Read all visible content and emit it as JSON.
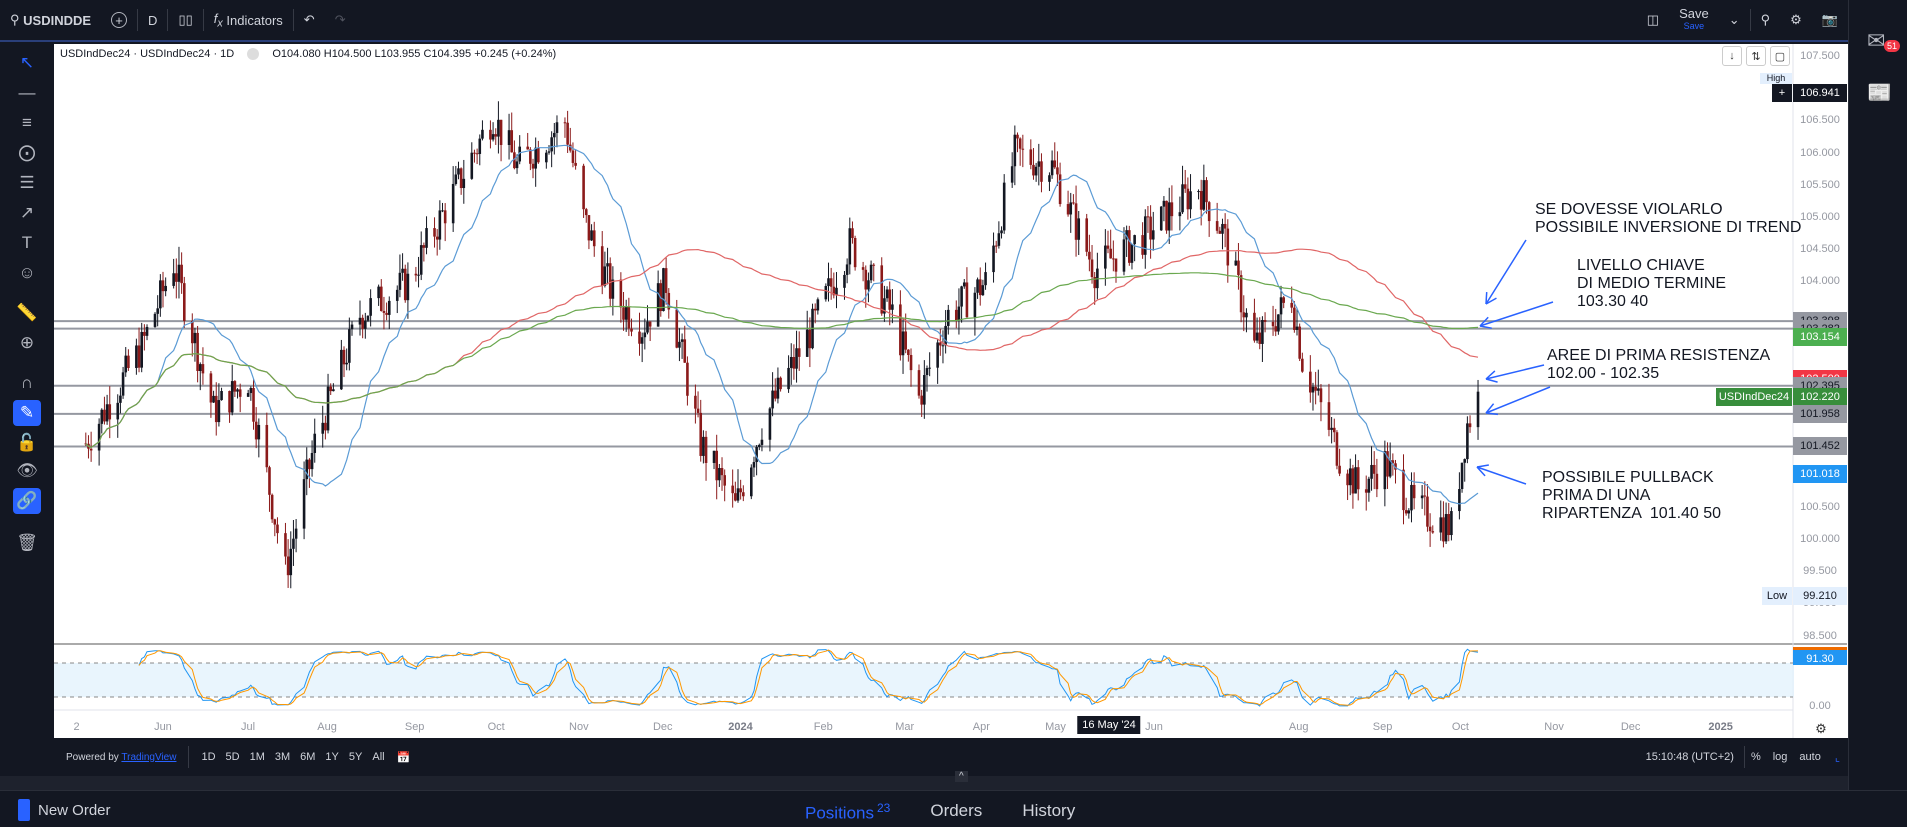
{
  "toolbar": {
    "symbol": "USDINDDE",
    "interval": "D",
    "indicators": "Indicators",
    "save": "Save",
    "save_sub": "Save"
  },
  "legend": {
    "title": "USDIndDec24 · USDIndDec24 · 1D",
    "ohlc": "O104.080 H104.500 L103.955 C104.395 +0.245 (+0.24%)"
  },
  "right_sidebar": {
    "mail_badge": "51"
  },
  "price_axis": {
    "ticks": [
      "107.500",
      "106.500",
      "106.000",
      "105.500",
      "105.000",
      "104.500",
      "104.000",
      "100.500",
      "100.000",
      "99.500",
      "99.000",
      "98.500"
    ],
    "labels": [
      {
        "v": "106.941",
        "c": "#131722",
        "t": "#ffffff",
        "p": 106.941
      },
      {
        "v": "103.398",
        "c": "#9598a1",
        "t": "#131722",
        "p": 103.398
      },
      {
        "v": "103.282",
        "c": "#9598a1",
        "t": "#131722",
        "p": 103.282
      },
      {
        "v": "103.154",
        "c": "#4caf50",
        "t": "#ffffff",
        "p": 103.154
      },
      {
        "v": "102.500",
        "c": "#f23645",
        "t": "#ffffff",
        "p": 102.5
      },
      {
        "v": "102.395",
        "c": "#9598a1",
        "t": "#131722",
        "p": 102.395
      },
      {
        "v": "102.220",
        "c": "#388e3c",
        "t": "#ffffff",
        "p": 102.22
      },
      {
        "v": "101.958",
        "c": "#9598a1",
        "t": "#131722",
        "p": 101.958
      },
      {
        "v": "101.452",
        "c": "#9598a1",
        "t": "#131722",
        "p": 101.452
      },
      {
        "v": "101.018",
        "c": "#2196f3",
        "t": "#ffffff",
        "p": 101.018
      }
    ],
    "symbol_tag": "USDIndDec24",
    "high_label": "High",
    "low_label": "Low",
    "low_value": "99.210",
    "rsi_value": "91.30",
    "rsi_zero": "0.00"
  },
  "levels": [
    103.398,
    103.282,
    102.395,
    101.958,
    101.452
  ],
  "annotations": [
    {
      "lines": [
        "SE DOVESSE VIOLARLO",
        "POSSIBILE INVERSIONE DI TREND"
      ]
    },
    {
      "lines": [
        "LIVELLO CHIAVE",
        "DI MEDIO TERMINE",
        "103.30 40"
      ]
    },
    {
      "lines": [
        "AREE DI PRIMA RESISTENZA",
        "102.00 - 102.35"
      ]
    },
    {
      "lines": [
        "POSSIBILE PULLBACK",
        "PRIMA DI UNA",
        "RIPARTENZA  101.40 50"
      ]
    }
  ],
  "time_axis": {
    "labels": [
      "2",
      "Jun",
      "Jul",
      "Aug",
      "Sep",
      "Oct",
      "Nov",
      "Dec",
      "2024",
      "Feb",
      "Mar",
      "Apr",
      "May",
      "Jun",
      "Aug",
      "Sep",
      "Oct",
      "Nov",
      "Dec",
      "2025"
    ],
    "crosshair": "16 May '24"
  },
  "bottom_toolbar": {
    "powered": "Powered by",
    "brand": "TradingView",
    "ranges": [
      "1D",
      "5D",
      "1M",
      "3M",
      "6M",
      "1Y",
      "5Y",
      "All"
    ],
    "time": "15:10:48 (UTC+2)",
    "pct": "%",
    "log": "log",
    "auto": "auto"
  },
  "panel": {
    "new_order": "New Order",
    "tabs": [
      {
        "label": "Positions",
        "badge": "23",
        "active": true
      },
      {
        "label": "Orders"
      },
      {
        "label": "History"
      }
    ]
  },
  "colors": {
    "up": "#131722",
    "down": "#8b1a1a",
    "ma_fast": "#5b9bd5",
    "ma_mid": "#e06666",
    "ma_slow": "#6aa84f",
    "accent": "#2962ff"
  },
  "chart_data": {
    "type": "candlestick",
    "symbol": "USDIndDec24",
    "price_path": [
      [
        "2023-05-03",
        101.5
      ],
      [
        "2023-05-24",
        103.0
      ],
      [
        "2023-06-05",
        104.3
      ],
      [
        "2023-06-20",
        102.0
      ],
      [
        "2023-07-03",
        102.5
      ],
      [
        "2023-07-17",
        99.5
      ],
      [
        "2023-07-28",
        101.5
      ],
      [
        "2023-08-14",
        103.5
      ],
      [
        "2023-09-01",
        104.0
      ],
      [
        "2023-09-22",
        105.7
      ],
      [
        "2023-10-03",
        106.6
      ],
      [
        "2023-10-12",
        105.8
      ],
      [
        "2023-10-30",
        106.5
      ],
      [
        "2023-11-06",
        105.0
      ],
      [
        "2023-11-17",
        103.8
      ],
      [
        "2023-11-28",
        103.3
      ],
      [
        "2023-12-07",
        104.0
      ],
      [
        "2023-12-20",
        101.5
      ],
      [
        "2024-01-02",
        100.5
      ],
      [
        "2024-01-12",
        101.8
      ],
      [
        "2024-01-31",
        103.3
      ],
      [
        "2024-02-14",
        104.6
      ],
      [
        "2024-03-01",
        103.5
      ],
      [
        "2024-03-11",
        102.2
      ],
      [
        "2024-03-22",
        103.5
      ],
      [
        "2024-04-05",
        104.0
      ],
      [
        "2024-04-16",
        106.0
      ],
      [
        "2024-04-30",
        105.8
      ],
      [
        "2024-05-16",
        104.2
      ],
      [
        "2024-06-03",
        104.7
      ],
      [
        "2024-06-24",
        105.5
      ],
      [
        "2024-07-03",
        104.8
      ],
      [
        "2024-07-15",
        103.0
      ],
      [
        "2024-07-29",
        103.8
      ],
      [
        "2024-08-02",
        102.8
      ],
      [
        "2024-08-16",
        101.3
      ],
      [
        "2024-08-23",
        100.8
      ],
      [
        "2024-09-02",
        101.2
      ],
      [
        "2024-09-13",
        100.5
      ],
      [
        "2024-09-27",
        100.2
      ],
      [
        "2024-10-03",
        101.8
      ],
      [
        "2024-10-07",
        102.22
      ]
    ],
    "ylim": [
      98.5,
      107.5
    ]
  }
}
